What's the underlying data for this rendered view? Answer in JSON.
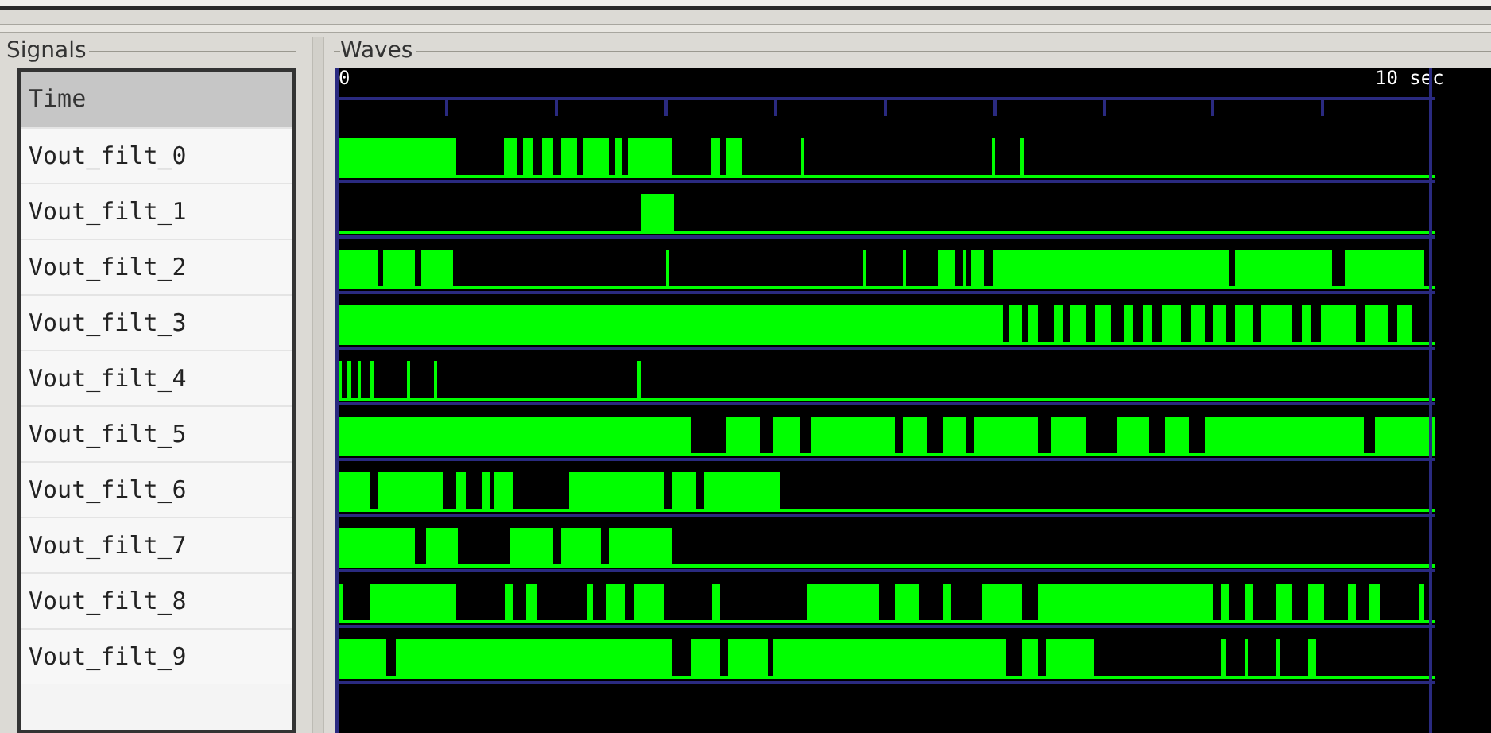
{
  "signals_panel": {
    "title": "Signals",
    "header": "Time",
    "signals": [
      {
        "name": "Vout_filt_0"
      },
      {
        "name": "Vout_filt_1"
      },
      {
        "name": "Vout_filt_2"
      },
      {
        "name": "Vout_filt_3"
      },
      {
        "name": "Vout_filt_4"
      },
      {
        "name": "Vout_filt_5"
      },
      {
        "name": "Vout_filt_6"
      },
      {
        "name": "Vout_filt_7"
      },
      {
        "name": "Vout_filt_8"
      },
      {
        "name": "Vout_filt_9"
      }
    ]
  },
  "waves_panel": {
    "title": "Waves",
    "time_start": "0",
    "time_end": "10 sec"
  }
}
